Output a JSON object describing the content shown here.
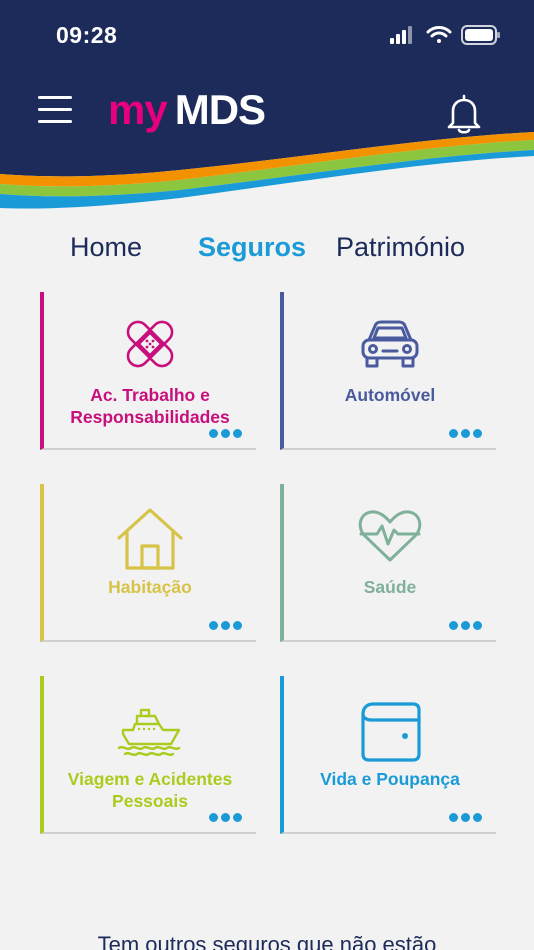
{
  "status_bar": {
    "time": "09:28"
  },
  "header": {
    "logo_my": "my",
    "logo_mds": "MDS",
    "colors": {
      "navy": "#1c2b5a",
      "magenta": "#e6007e",
      "blue": "#1a9bd7",
      "green": "#8cc63f",
      "orange": "#f39200"
    }
  },
  "tabs": [
    {
      "label": "Home",
      "active": false
    },
    {
      "label": "Seguros",
      "active": true
    },
    {
      "label": "Património",
      "active": false
    }
  ],
  "cards": [
    {
      "label": "Ac. Trabalho e Responsabilidades",
      "icon": "bandage-icon",
      "color": "#c8107d"
    },
    {
      "label": "Automóvel",
      "icon": "car-icon",
      "color": "#4a5a9e"
    },
    {
      "label": "Habitação",
      "icon": "house-icon",
      "color": "#d6c347"
    },
    {
      "label": "Saúde",
      "icon": "heart-pulse-icon",
      "color": "#7fb09a"
    },
    {
      "label": "Viagem e Acidentes Pessoais",
      "icon": "ship-icon",
      "color": "#a9cc1f"
    },
    {
      "label": "Vida e Poupança",
      "icon": "wallet-icon",
      "color": "#1a9bd7"
    }
  ],
  "footer": {
    "text": "Tem outros seguros que não estão"
  }
}
